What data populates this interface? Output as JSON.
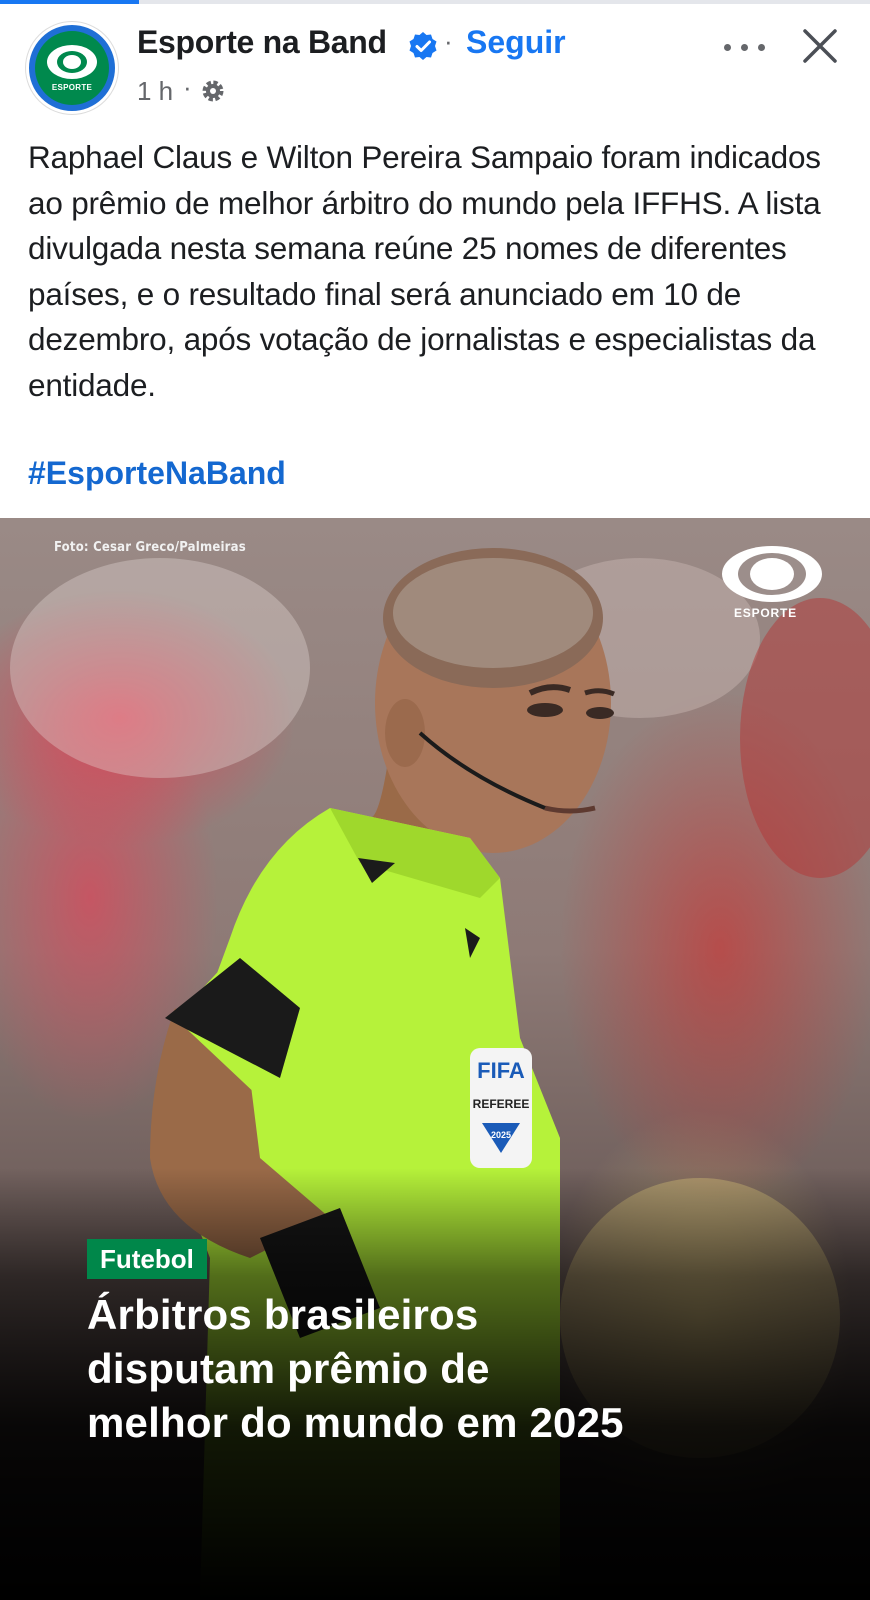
{
  "progress": {
    "fraction": 0.16
  },
  "header": {
    "page_name": "Esporte na Band",
    "verified": true,
    "separator": "·",
    "follow_label": "Seguir",
    "time": "1 h",
    "meta_separator": "·",
    "avatar_label": "ESPORTE",
    "icons": [
      "verified-icon",
      "globe-icon",
      "more-icon",
      "close-icon"
    ]
  },
  "post": {
    "text": "Raphael Claus e Wilton Pereira Sampaio foram indicados ao prêmio de melhor árbitro do mundo pela IFFHS. A lista divulgada nesta semana reúne 25 nomes de diferentes países, e o resultado final será anunciado em 10 de dezembro, após votação de jornalistas e especialistas da entidade.",
    "hashtag": "#EsporteNaBand"
  },
  "image": {
    "credit": "Foto: Cesar Greco/Palmeiras",
    "brand_label": "ESPORTE",
    "badge_fifa": "FIFA",
    "badge_referee": "REFEREE",
    "badge_year": "2025",
    "category": "Futebol",
    "headline_lines": [
      "Árbitros brasileiros",
      "disputam prêmio de",
      "melhor do mundo em 2025"
    ]
  },
  "colors": {
    "accent": "#1877f2",
    "hashtag": "#1468d0",
    "category_badge": "#00874a",
    "referee_shirt": "#b6f23a",
    "brand_green": "#00894d"
  }
}
